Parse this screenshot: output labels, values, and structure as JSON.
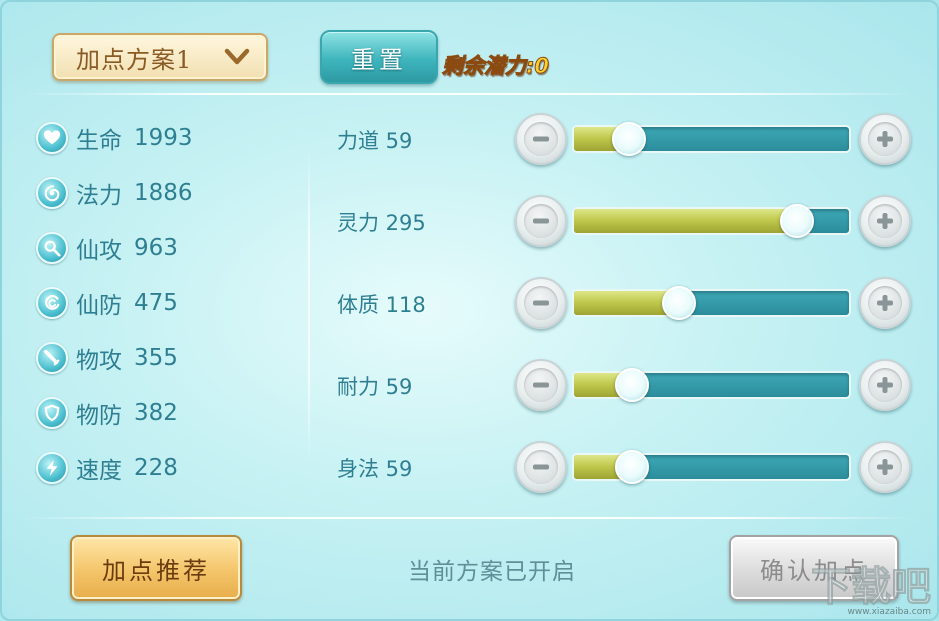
{
  "header": {
    "plan_dropdown_label": "加点方案1",
    "reset_label": "重置",
    "remaining_potential": "剩余潜力:0"
  },
  "stats": [
    {
      "name": "生命",
      "value": "1993",
      "icon": "heart-icon"
    },
    {
      "name": "法力",
      "value": "1886",
      "icon": "spiral-icon"
    },
    {
      "name": "仙攻",
      "value": "963",
      "icon": "magic-attack-icon"
    },
    {
      "name": "仙防",
      "value": "475",
      "icon": "magic-defense-icon"
    },
    {
      "name": "物攻",
      "value": "355",
      "icon": "sword-icon"
    },
    {
      "name": "物防",
      "value": "382",
      "icon": "shield-icon"
    },
    {
      "name": "速度",
      "value": "228",
      "icon": "lightning-icon"
    }
  ],
  "attributes": [
    {
      "label": "力道 59",
      "level": 0.2
    },
    {
      "label": "灵力 295",
      "level": 0.81
    },
    {
      "label": "体质 118",
      "level": 0.38
    },
    {
      "label": "耐力 59",
      "level": 0.21
    },
    {
      "label": "身法 59",
      "level": 0.21
    }
  ],
  "footer": {
    "recommend_label": "加点推荐",
    "status_text": "当前方案已开启",
    "confirm_label": "确认加点"
  },
  "watermark": {
    "text": "下载吧",
    "url": "www.xiazaiba.com"
  },
  "colors": {
    "accent_teal": "#3fb5bd",
    "text_teal": "#2f7f92",
    "gold_text": "#ffcf2e",
    "slider_fill": "#c1c94e"
  }
}
